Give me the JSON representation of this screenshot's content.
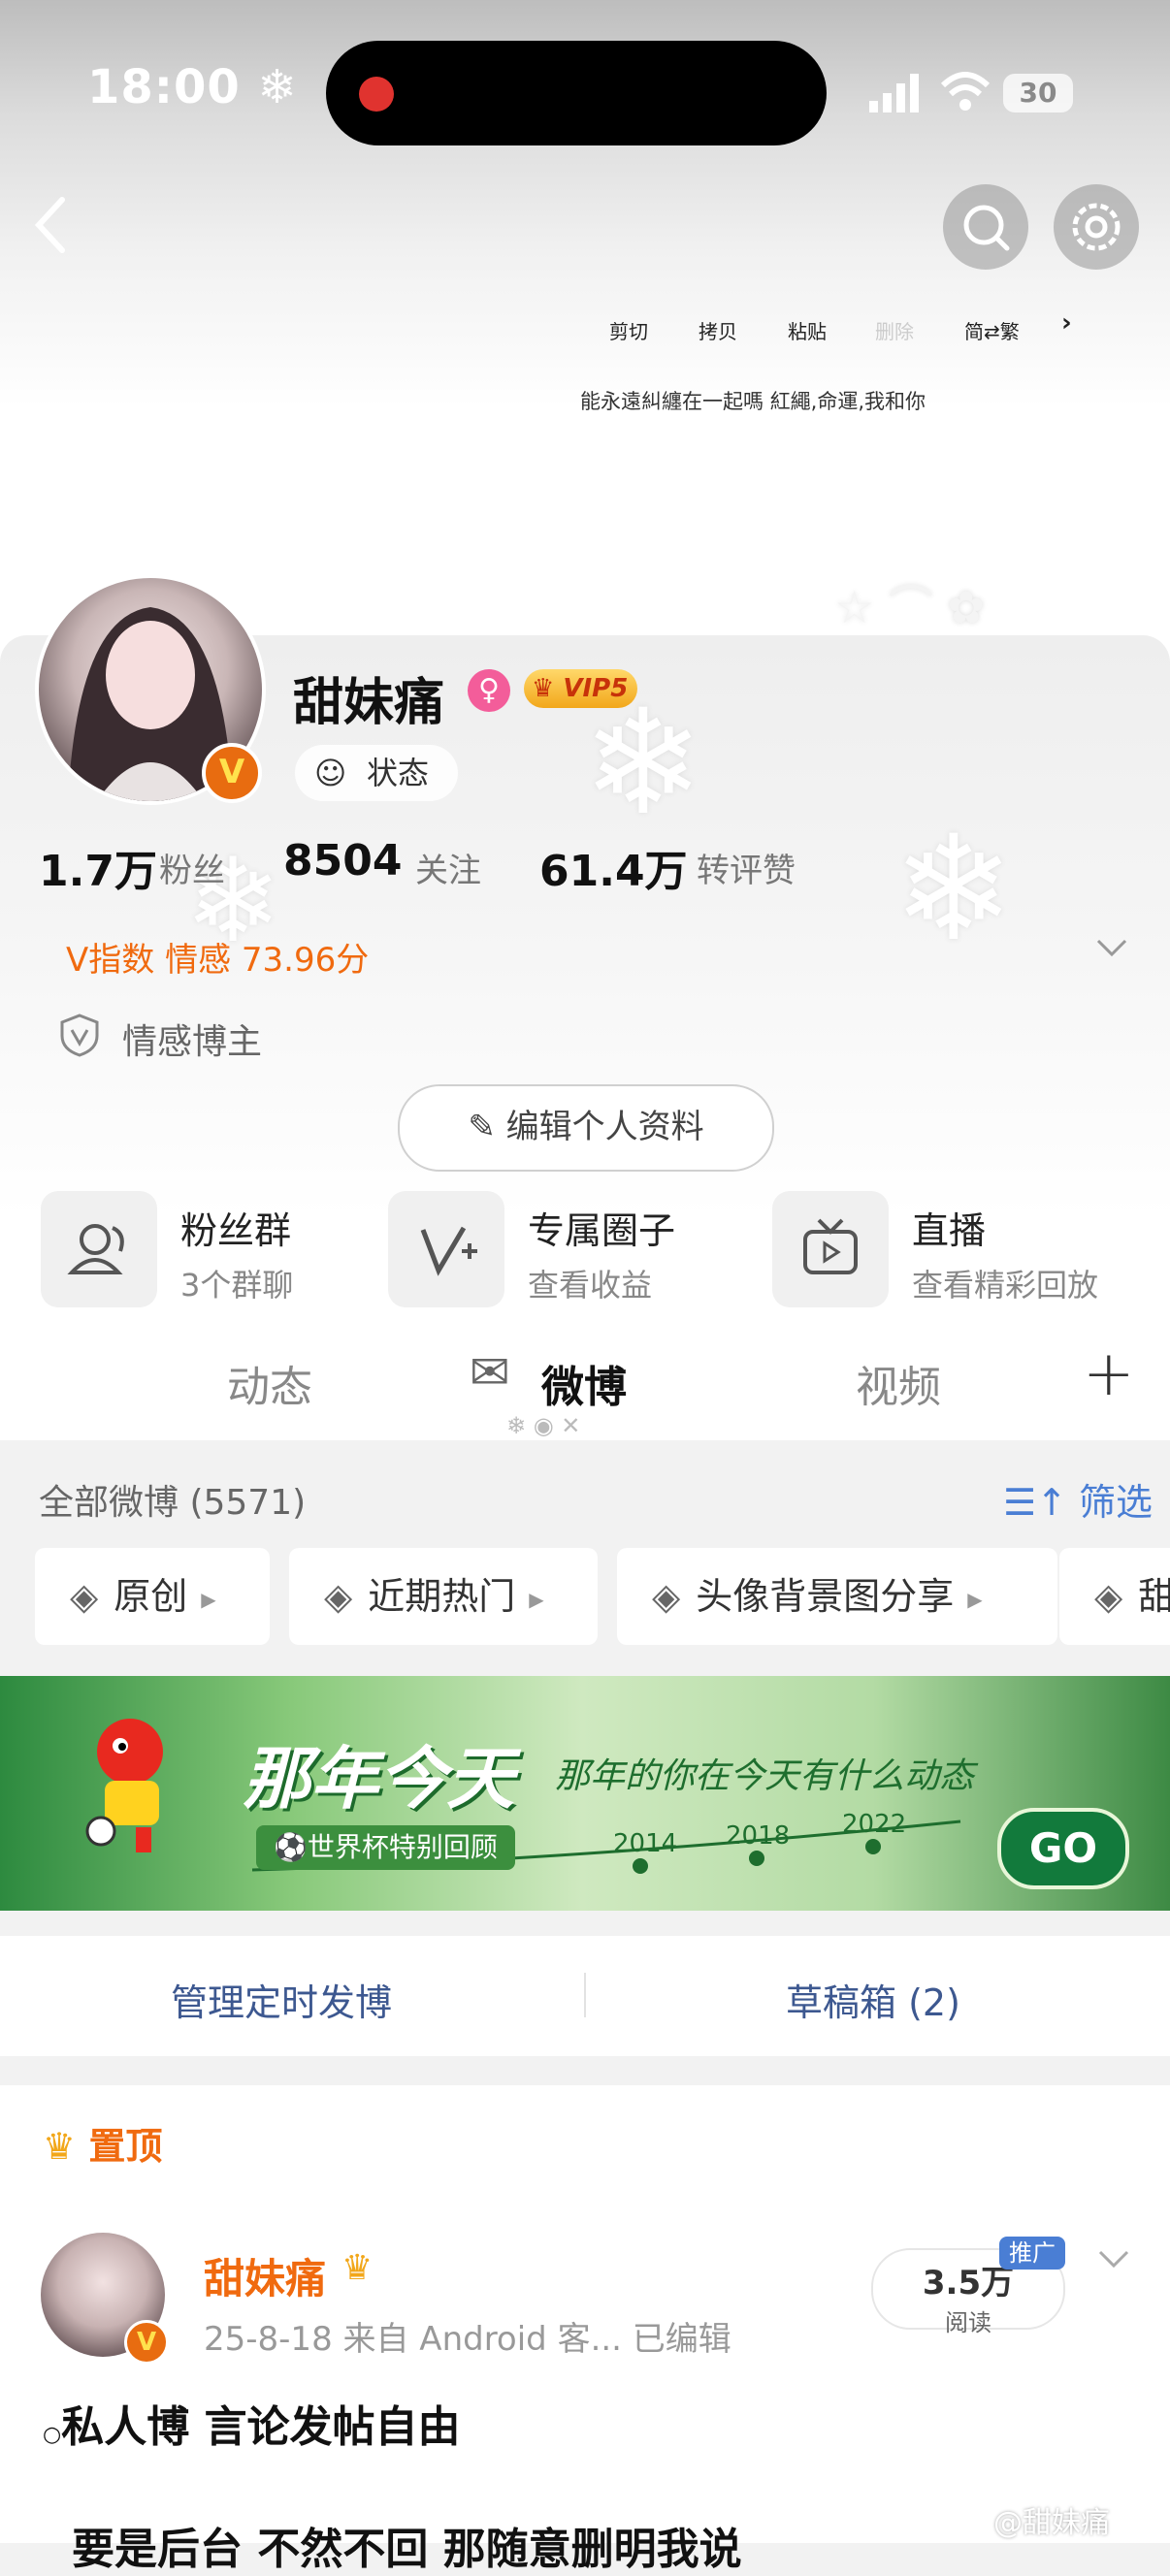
{
  "status_bar": {
    "time": "18:00",
    "battery": "30"
  },
  "context_menu": {
    "items": [
      "剪切",
      "拷贝",
      "粘贴",
      "删除",
      "简⇄繁"
    ],
    "snippet": "能永遠糾纏在一起嗎  紅繩,命運,我和你"
  },
  "profile": {
    "name": "甜妹痛",
    "vip": "VIP5",
    "status_label": "状态",
    "stats": [
      {
        "value": "1.7万",
        "label": "粉丝"
      },
      {
        "value": "8504",
        "label": "关注"
      },
      {
        "value": "61.4万",
        "label": "转评赞"
      }
    ],
    "v_index": "V指数  情感 73.96分",
    "blogger_type": "情感博主",
    "edit_button": "编辑个人资料"
  },
  "functions": [
    {
      "title": "粉丝群",
      "subtitle": "3个群聊"
    },
    {
      "title": "专属圈子",
      "subtitle": "查看收益"
    },
    {
      "title": "直播",
      "subtitle": "查看精彩回放"
    }
  ],
  "tabs": [
    "动态",
    "微博",
    "视频"
  ],
  "weibo_list": {
    "count_label": "全部微博 (5571)",
    "filter_label": "筛选",
    "chips": [
      "原创",
      "近期热门",
      "头像背景图分享",
      "甜"
    ]
  },
  "banner": {
    "title": "那年今天",
    "subtitle": "那年的你在今天有什么动态",
    "tag": "世界杯特别回顾",
    "years": [
      "2014",
      "2018",
      "2022"
    ],
    "go": "GO"
  },
  "actions": [
    "管理定时发博",
    "草稿箱 (2)"
  ],
  "post": {
    "pinned_label": "置顶",
    "author": "甜妹痛",
    "meta": "25-8-18  来自 Android 客...  已编辑",
    "reads_value": "3.5万",
    "reads_label": "阅读",
    "promo": "推广",
    "text": "私人博 言论发帖自由",
    "text_partial": "要是后台 不然不回 那随意删明我说",
    "watermark": "@甜妹痛"
  },
  "colors": {
    "accent_orange": "#f06a0f",
    "link_blue": "#4a7ed4",
    "action_blue": "#3d5890"
  },
  "icons": [
    "back-icon",
    "search-icon",
    "settings-icon",
    "status-face-icon",
    "shield-v-icon",
    "pencil-icon",
    "fans-group-icon",
    "circle-v-icon",
    "live-tv-icon",
    "plus-icon",
    "filter-icon",
    "layers-icon",
    "crown-icon",
    "chevron-down-icon"
  ]
}
